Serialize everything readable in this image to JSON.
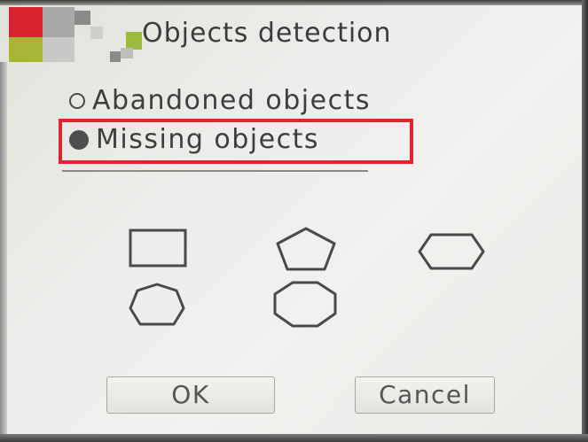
{
  "dialog": {
    "title": "Objects detection"
  },
  "detection_mode": {
    "options": [
      {
        "label": "Abandoned objects",
        "selected": false
      },
      {
        "label": "Missing objects",
        "selected": true
      }
    ]
  },
  "shapes": [
    {
      "name": "square-icon",
      "sides": 4
    },
    {
      "name": "pentagon-icon",
      "sides": 5
    },
    {
      "name": "hexagon-icon",
      "sides": 6
    },
    {
      "name": "heptagon-icon",
      "sides": 7
    },
    {
      "name": "octagon-icon",
      "sides": 8
    }
  ],
  "buttons": {
    "ok_label": "OK",
    "cancel_label": "Cancel"
  },
  "colors": {
    "highlight": "#e0252f",
    "text": "#3e3e3e",
    "logo_red": "#d8242c",
    "logo_green": "#9bbb3e"
  }
}
